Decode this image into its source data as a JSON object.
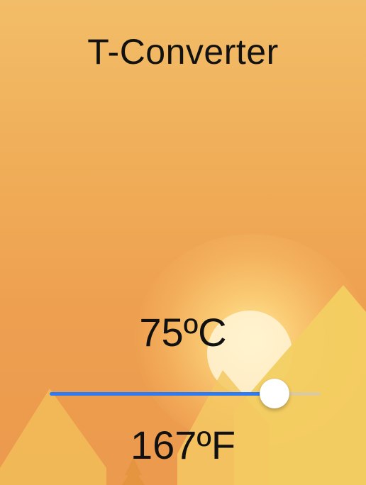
{
  "app": {
    "title": "T-Converter"
  },
  "converter": {
    "celsius_display": "75ºC",
    "fahrenheit_display": "167ºF",
    "slider_fraction": 0.83
  },
  "colors": {
    "background_top": "#f2bd68",
    "background_bottom": "#ec9a4d",
    "slider_fill": "#2f7bf4",
    "slider_track": "#d8d0c4",
    "slider_thumb": "#ffffff"
  }
}
